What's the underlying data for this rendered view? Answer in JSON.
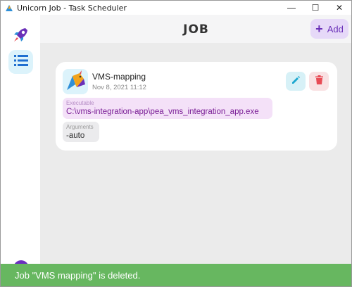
{
  "window": {
    "title": "Unicorn Job - Task Scheduler",
    "controls": {
      "minimize": "—",
      "maximize": "☐",
      "close": "✕"
    }
  },
  "sidebar": {
    "logo_icon": "rocket-icon",
    "items": [
      {
        "icon": "list-icon",
        "active": true
      }
    ],
    "accent": "#6b2fbf"
  },
  "header": {
    "title": "JOB",
    "add_button": {
      "icon": "+",
      "label": "Add"
    }
  },
  "job": {
    "name": "VMS-mapping",
    "date": "Nov 8, 2021 11:12",
    "executable_label": "Executable",
    "executable_value": "C:\\vms-integration-app\\pea_vms_integration_app.exe",
    "arguments_label": "Arguments",
    "arguments_value": "-auto",
    "edit_icon": "pencil-icon",
    "delete_icon": "trash-icon"
  },
  "snackbar": {
    "message": "Job \"VMS mapping\" is deleted.",
    "color": "#67b760"
  },
  "colors": {
    "accent_purple": "#6a30b8",
    "edit_blue": "#1aa7cf",
    "delete_red": "#e84b55",
    "executable_text": "#7a1e96"
  }
}
